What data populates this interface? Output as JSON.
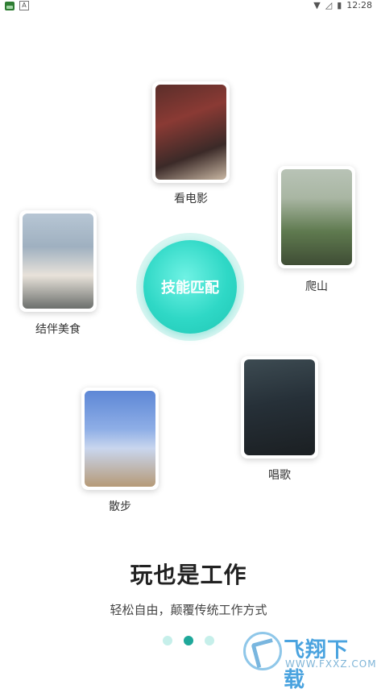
{
  "status_bar": {
    "time": "12:28",
    "app_icon": "android-app-icon",
    "a_label": "A"
  },
  "center_button": {
    "label": "技能匹配"
  },
  "cards": [
    {
      "id": "movie",
      "label": "看电影",
      "photo": "photo-movie-theater",
      "colors": [
        "#3b2a28",
        "#8a3a34",
        "#c9b7a3"
      ]
    },
    {
      "id": "hiking",
      "label": "爬山",
      "photo": "photo-mountain",
      "colors": [
        "#a9b6a3",
        "#5f7a4f",
        "#3f4d35"
      ]
    },
    {
      "id": "food",
      "label": "结伴美食",
      "photo": "photo-cafe",
      "colors": [
        "#9fb0c0",
        "#e8e2da",
        "#6b6f6c"
      ]
    },
    {
      "id": "singing",
      "label": "唱歌",
      "photo": "photo-karaoke",
      "colors": [
        "#263038",
        "#3d4b52",
        "#1b1f22"
      ]
    },
    {
      "id": "walk",
      "label": "散步",
      "photo": "photo-beach",
      "colors": [
        "#5d87d6",
        "#c9d6ee",
        "#b69a77"
      ]
    }
  ],
  "headline": "玩也是工作",
  "subheadline": "轻松自由，颠覆传统工作方式",
  "pagination": {
    "count": 3,
    "active": 2
  },
  "watermark": {
    "text": "飞翔下载",
    "url": "WWW.FXXZ.COM"
  },
  "accent": "#1fc6b4"
}
